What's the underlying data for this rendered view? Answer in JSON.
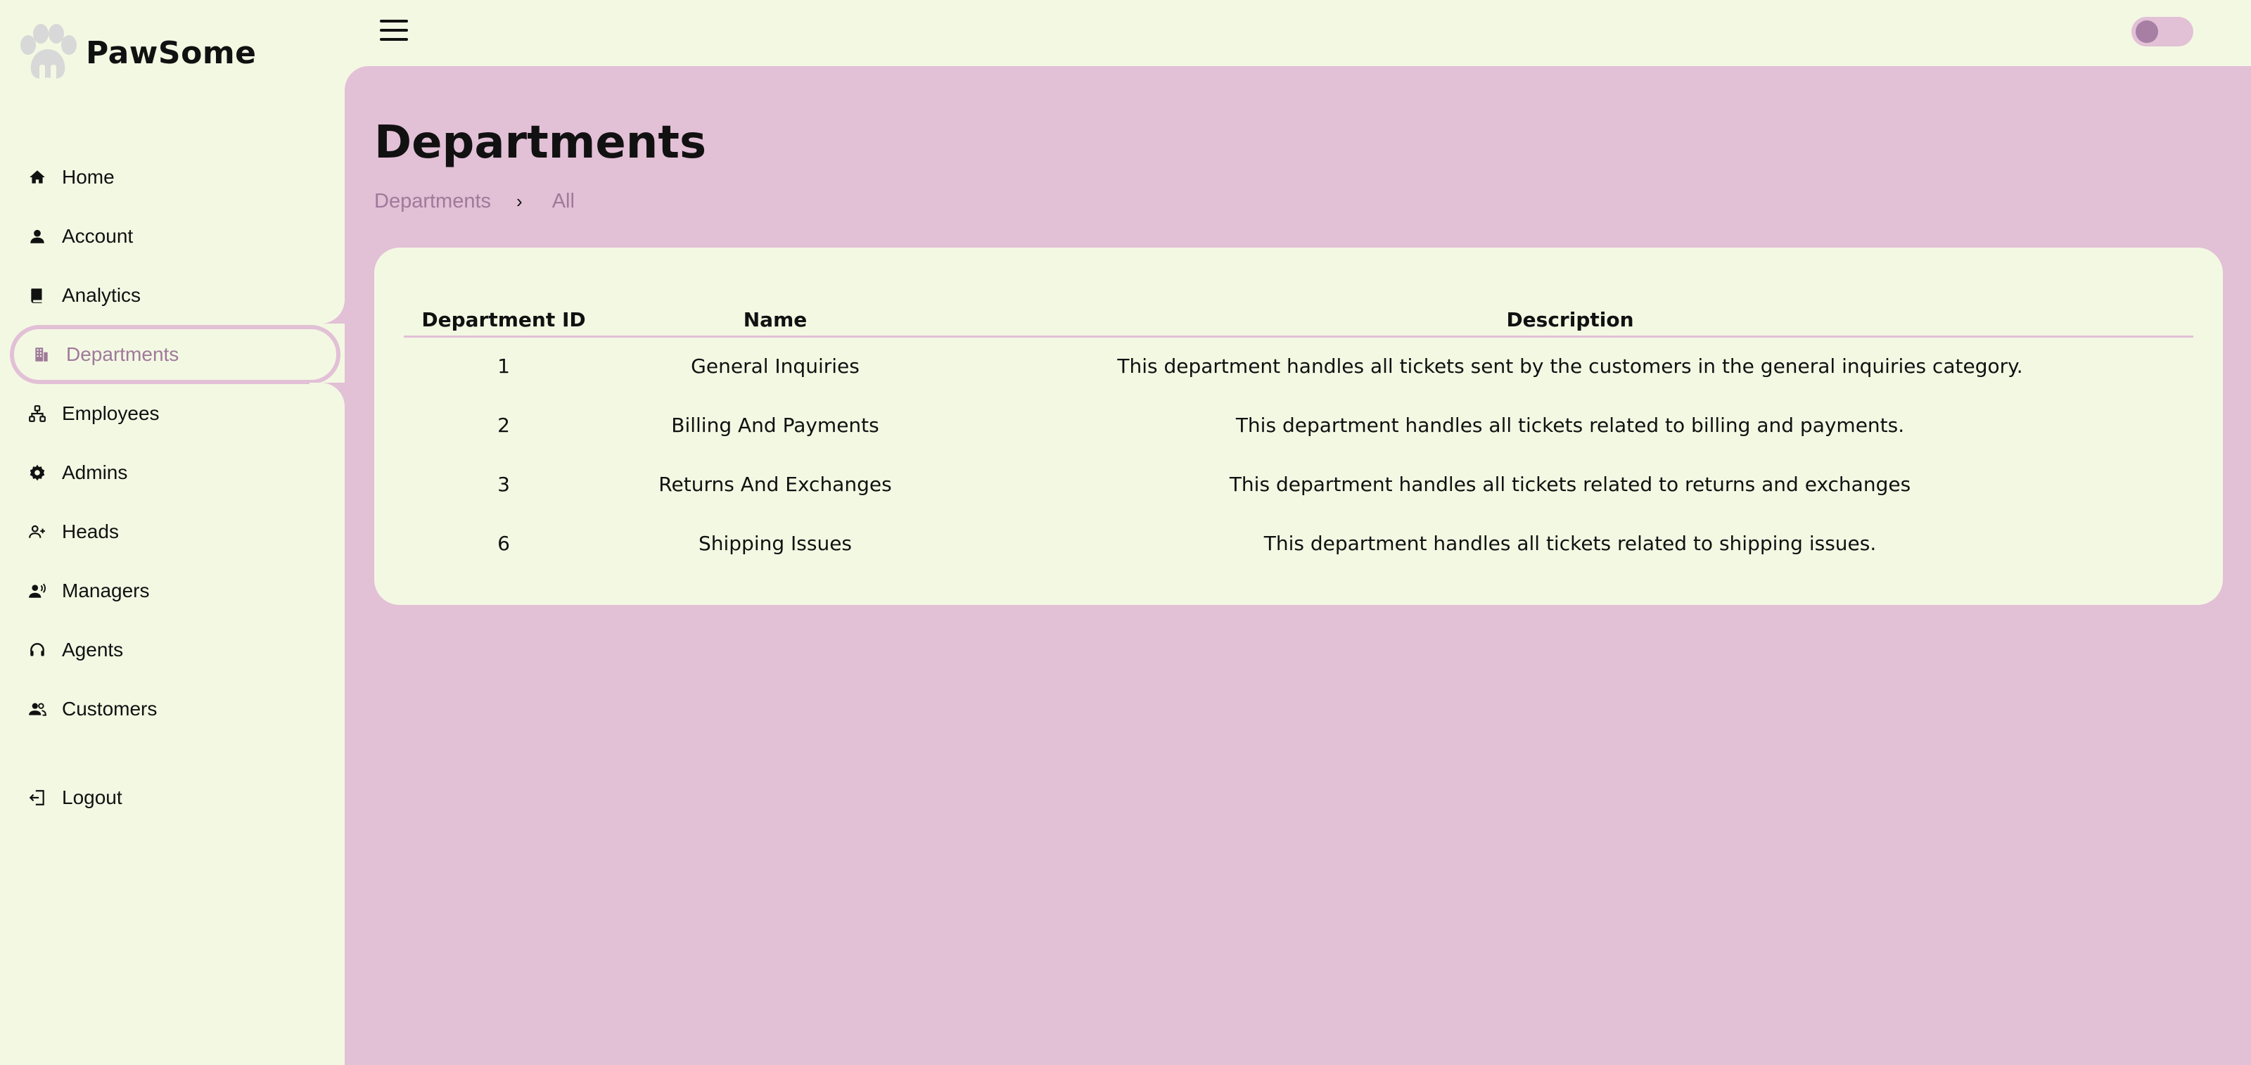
{
  "brand": {
    "name": "PawSome",
    "logo_icon": "paw-icon"
  },
  "sidebar": {
    "items": [
      {
        "label": "Home",
        "icon": "home-icon"
      },
      {
        "label": "Account",
        "icon": "person-icon"
      },
      {
        "label": "Analytics",
        "icon": "book-icon"
      },
      {
        "label": "Departments",
        "icon": "building-icon",
        "active": true
      },
      {
        "label": "Employees",
        "icon": "org-chart-icon"
      },
      {
        "label": "Admins",
        "icon": "gear-icon"
      },
      {
        "label": "Heads",
        "icon": "person-add-icon"
      },
      {
        "label": "Managers",
        "icon": "person-voice-icon"
      },
      {
        "label": "Agents",
        "icon": "headset-icon"
      },
      {
        "label": "Customers",
        "icon": "people-icon"
      }
    ],
    "logout": {
      "label": "Logout",
      "icon": "logout-icon"
    }
  },
  "header": {
    "menu_icon": "hamburger-icon",
    "theme_toggle": "off"
  },
  "page": {
    "title": "Departments",
    "breadcrumb": [
      "Departments",
      "All"
    ],
    "breadcrumb_separator": "›"
  },
  "table": {
    "headers": [
      "Department ID",
      "Name",
      "Description"
    ],
    "rows": [
      {
        "id": "1",
        "name": "General Inquiries",
        "description": "This department handles all tickets sent by the customers in the general inquiries category."
      },
      {
        "id": "2",
        "name": "Billing And Payments",
        "description": "This department handles all tickets related to billing and payments."
      },
      {
        "id": "3",
        "name": "Returns And Exchanges",
        "description": "This department handles all tickets related to returns and exchanges"
      },
      {
        "id": "6",
        "name": "Shipping Issues",
        "description": "This department handles all tickets related to shipping issues."
      }
    ]
  },
  "colors": {
    "background": "#f3f8e3",
    "main_panel": "#e2c0d6",
    "accent": "#9f7a9a",
    "toggle_knob": "#a77fa4"
  }
}
